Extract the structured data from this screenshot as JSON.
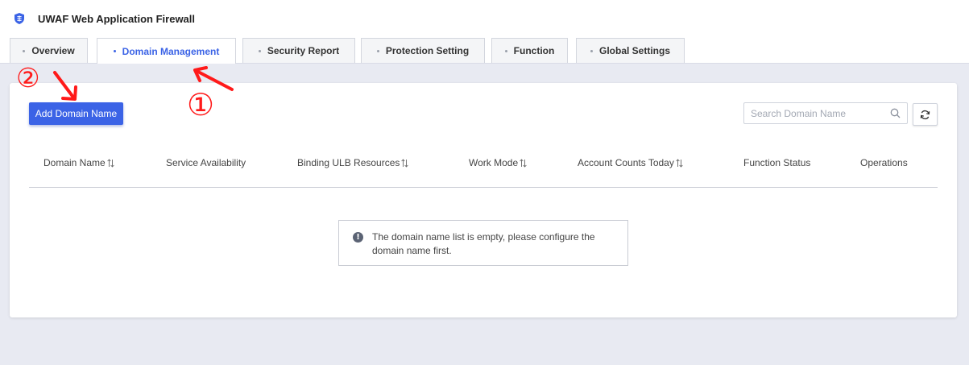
{
  "app": {
    "title": "UWAF Web Application Firewall"
  },
  "tabs": [
    {
      "label": "Overview",
      "active": false
    },
    {
      "label": "Domain Management",
      "active": true
    },
    {
      "label": "Security Report",
      "active": false
    },
    {
      "label": "Protection Setting",
      "active": false
    },
    {
      "label": "Function",
      "active": false
    },
    {
      "label": "Global Settings",
      "active": false
    }
  ],
  "toolbar": {
    "add_label": "Add Domain Name",
    "search_placeholder": "Search Domain Name",
    "search_value": ""
  },
  "table": {
    "columns": [
      {
        "label": "Domain Name",
        "sortable": true
      },
      {
        "label": "Service Availability",
        "sortable": false
      },
      {
        "label": "Binding ULB Resources",
        "sortable": true
      },
      {
        "label": "Work Mode",
        "sortable": true
      },
      {
        "label": "Account Counts Today",
        "sortable": true
      },
      {
        "label": "Function Status",
        "sortable": false
      },
      {
        "label": "Operations",
        "sortable": false
      }
    ],
    "rows": [],
    "empty_message": "The domain name list is empty, please configure the domain name first."
  },
  "annotations": {
    "marker_1": "①",
    "marker_2": "②"
  },
  "colors": {
    "accent": "#3b63e6",
    "annotation": "#ff1a1a",
    "background": "#e8eaf2"
  },
  "icons": [
    "shield-icon",
    "search-icon",
    "refresh-icon",
    "sort-icon",
    "info-icon"
  ]
}
